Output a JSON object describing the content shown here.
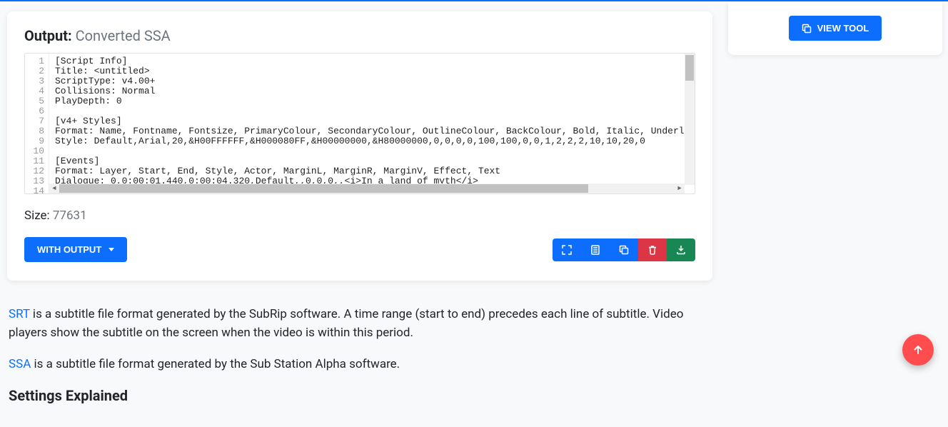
{
  "output": {
    "label": "Output:",
    "title": "Converted SSA",
    "lines": [
      "[Script Info]",
      "Title: <untitled>",
      "ScriptType: v4.00+",
      "Collisions: Normal",
      "PlayDepth: 0",
      "",
      "[v4+ Styles]",
      "Format: Name, Fontname, Fontsize, PrimaryColour, SecondaryColour, OutlineColour, BackColour, Bold, Italic, Underline, StrikeOut, ScaleX, ScaleY, Spacing, Angle, BorderStyle, Outline, Shadow, Alignment, MarginL, MarginR, MarginV, Encoding",
      "Style: Default,Arial,20,&H00FFFFFF,&H000080FF,&H00000000,&H80000000,0,0,0,0,100,100,0,0,1,2,2,2,10,10,20,0",
      "",
      "[Events]",
      "Format: Layer, Start, End, Style, Actor, MarginL, MarginR, MarginV, Effect, Text",
      "Dialogue: 0,0:00:01.440,0:00:04.320,Default,,0,0,0,,<i>In a land of myth</i>",
      ""
    ],
    "line_count": 14,
    "size_label": "Size:",
    "size_value": "77631",
    "with_output_label": "WITH OUTPUT"
  },
  "icons": {
    "fullscreen": "fullscreen-icon",
    "notes": "notes-icon",
    "copy": "copy-icon",
    "trash": "trash-icon",
    "download": "download-icon",
    "arrow_up": "arrow-up-icon",
    "copy_sm": "copy-icon"
  },
  "side": {
    "view_tool_label": "VIEW TOOL"
  },
  "description": {
    "srt_link": "SRT",
    "srt_text": " is a subtitle file format generated by the SubRip software. A time range (start to end) precedes each line of subtitle. Video players show the subtitle on the screen when the video is within this period.",
    "ssa_link": "SSA",
    "ssa_text": " is a subtitle file format generated by the Sub Station Alpha software."
  },
  "settings_heading": "Settings Explained"
}
